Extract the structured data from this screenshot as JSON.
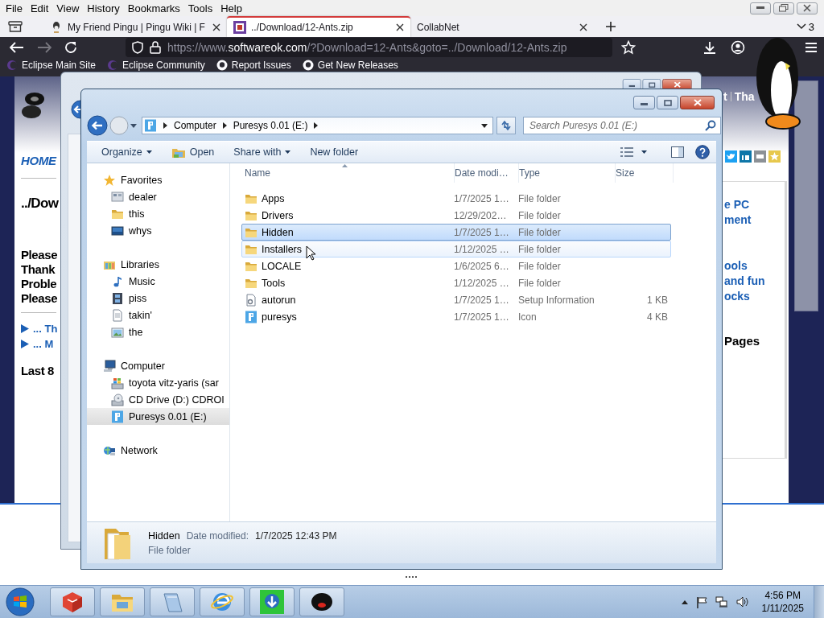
{
  "browser": {
    "menu": [
      "File",
      "Edit",
      "View",
      "History",
      "Bookmarks",
      "Tools",
      "Help"
    ],
    "tabs": [
      {
        "title": "My Friend Pingu | Pingu Wiki | F",
        "selected": false,
        "favicon": true
      },
      {
        "title": "../Download/12-Ants.zip",
        "selected": true,
        "favicon": true
      },
      {
        "title": "CollabNet",
        "selected": false,
        "favicon": false
      }
    ],
    "tab_count": "3",
    "address": {
      "prefix": "https://www.",
      "domain": "softwareok.com",
      "path": "/?Download=12-Ants&goto=../Download/12-Ants.zip"
    },
    "bookmarks": [
      {
        "label": "Eclipse Main Site",
        "kind": "moon"
      },
      {
        "label": "Eclipse Community",
        "kind": "moon"
      },
      {
        "label": "Report Issues",
        "kind": "round"
      },
      {
        "label": "Get New Releases",
        "kind": "round"
      }
    ]
  },
  "web_page": {
    "header_text": [
      "t",
      "Tha"
    ],
    "nav_link": "HOME",
    "heading": "../Dow",
    "notice_lines": [
      "Please",
      "Thank",
      "Proble",
      "Please"
    ],
    "links": [
      "... Th",
      "... M"
    ],
    "section_title": "Last 8",
    "sidebar_links": [
      {
        "lines": [
          "e PC",
          "ment"
        ]
      },
      {
        "lines": [
          "ools",
          "and fun",
          "ocks"
        ]
      }
    ],
    "sidebar_title": "Pages"
  },
  "explorer": {
    "breadcrumb": [
      "Computer",
      "Puresys 0.01 (E:)"
    ],
    "search_placeholder": "Search Puresys 0.01 (E:)",
    "toolbar": [
      {
        "label": "Organize",
        "kind": "menu"
      },
      {
        "label": "Open",
        "kind": "open"
      },
      {
        "label": "Share with",
        "kind": "menu"
      },
      {
        "label": "New folder",
        "kind": "plain"
      }
    ],
    "navigation": [
      {
        "label": "Favorites",
        "kind": "star",
        "selected": false,
        "children": [
          {
            "label": "dealer",
            "kind": "desktop",
            "selected": false
          },
          {
            "label": "this",
            "kind": "folder",
            "selected": false
          },
          {
            "label": "whys",
            "kind": "monitor",
            "selected": false
          }
        ]
      },
      {
        "label": "Libraries",
        "kind": "library",
        "selected": false,
        "children": [
          {
            "label": "Music",
            "kind": "music",
            "selected": false
          },
          {
            "label": "piss",
            "kind": "video",
            "selected": false
          },
          {
            "label": "takin'",
            "kind": "document",
            "selected": false
          },
          {
            "label": "the",
            "kind": "picture",
            "selected": false
          }
        ]
      },
      {
        "label": "Computer",
        "kind": "computer",
        "selected": false,
        "children": [
          {
            "label": "toyota vitz-yaris (sar",
            "kind": "drive",
            "selected": false
          },
          {
            "label": "CD Drive (D:) CDROI",
            "kind": "disc",
            "selected": false
          },
          {
            "label": "Puresys 0.01 (E:)",
            "kind": "removable",
            "selected": true
          }
        ]
      },
      {
        "label": "Network",
        "kind": "network",
        "selected": false
      }
    ],
    "columns": [
      "Name",
      "Date modi…",
      "Type",
      "Size"
    ],
    "files": [
      {
        "name": "Apps",
        "date": "1/7/2025 1…",
        "type": "File folder",
        "kind": "folder",
        "selected": false,
        "hovered": false
      },
      {
        "name": "Drivers",
        "date": "12/29/202…",
        "type": "File folder",
        "kind": "folder",
        "selected": false,
        "hovered": false
      },
      {
        "name": "Hidden",
        "date": "1/7/2025 1…",
        "type": "File folder",
        "kind": "folder",
        "selected": true,
        "hovered": false
      },
      {
        "name": "Installers",
        "date": "1/12/2025 …",
        "type": "File folder",
        "kind": "folder",
        "selected": false,
        "hovered": true
      },
      {
        "name": "LOCALE",
        "date": "1/6/2025 6…",
        "type": "File folder",
        "kind": "folder",
        "selected": false,
        "hovered": false
      },
      {
        "name": "Tools",
        "date": "1/12/2025 …",
        "type": "File folder",
        "kind": "folder",
        "selected": false,
        "hovered": false
      },
      {
        "name": "autorun",
        "date": "1/7/2025 1…",
        "type": "Setup Information",
        "size": "1 KB",
        "kind": "setup",
        "selected": false,
        "hovered": false
      },
      {
        "name": "puresys",
        "date": "1/7/2025 1…",
        "type": "Icon",
        "size": "4 KB",
        "kind": "image",
        "selected": false,
        "hovered": false
      }
    ],
    "details": {
      "name": "Hidden",
      "date_label": "Date modified:",
      "date": "1/7/2025 12:43 PM",
      "type": "File folder"
    }
  },
  "taskbar": {
    "apps": [
      {
        "kind": "cube"
      },
      {
        "kind": "folder"
      },
      {
        "kind": "notepad"
      },
      {
        "kind": "globe"
      },
      {
        "kind": "download"
      },
      {
        "kind": "ball"
      }
    ],
    "time": "4:56 PM",
    "date": "1/11/2025"
  }
}
